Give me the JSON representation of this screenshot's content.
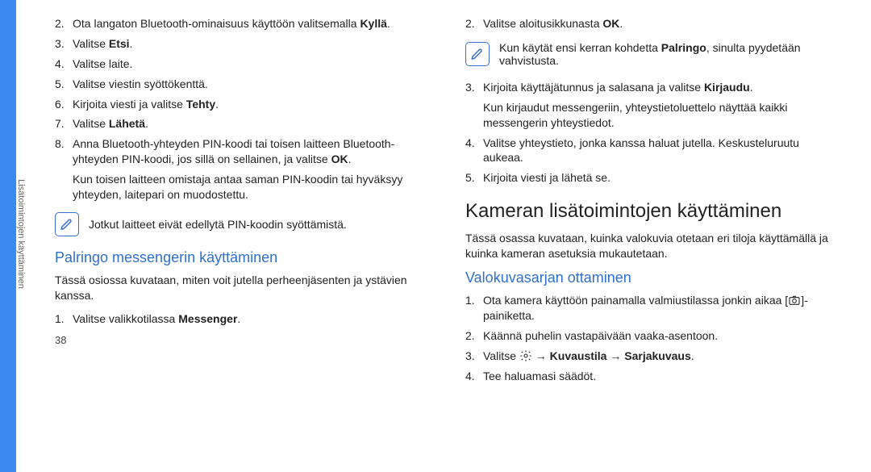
{
  "sidebar": {
    "label": "Lisätoimintojen käyttäminen"
  },
  "left": {
    "steps_a": [
      {
        "n": "2.",
        "pre": "Ota langaton Bluetooth-ominaisuus käyttöön valitsemalla ",
        "bold": "Kyllä",
        "post": "."
      },
      {
        "n": "3.",
        "pre": "Valitse ",
        "bold": "Etsi",
        "post": "."
      },
      {
        "n": "4.",
        "pre": "Valitse laite.",
        "bold": "",
        "post": ""
      },
      {
        "n": "5.",
        "pre": "Valitse viestin syöttökenttä.",
        "bold": "",
        "post": ""
      },
      {
        "n": "6.",
        "pre": "Kirjoita viesti ja valitse ",
        "bold": "Tehty",
        "post": "."
      },
      {
        "n": "7.",
        "pre": "Valitse ",
        "bold": "Lähetä",
        "post": "."
      },
      {
        "n": "8.",
        "pre": "Anna Bluetooth-yhteyden PIN-koodi tai toisen laitteen Bluetooth-yhteyden PIN-koodi, jos sillä on sellainen, ja valitse ",
        "bold": "OK",
        "post": "."
      }
    ],
    "sub8": "Kun toisen laitteen omistaja antaa saman PIN-koodin tai hyväksyy yhteyden, laitepari on muodostettu.",
    "note1": "Jotkut laitteet eivät edellytä PIN-koodin syöttämistä.",
    "h_palringo": "Palringo messengerin käyttäminen",
    "palringo_lede": "Tässä osiossa kuvataan, miten voit jutella perheenjäsenten ja ystävien kanssa.",
    "steps_b1": {
      "n": "1.",
      "pre": "Valitse valikkotilassa ",
      "bold": "Messenger",
      "post": "."
    }
  },
  "right": {
    "steps_b2": {
      "n": "2.",
      "pre": "Valitse aloitusikkunasta ",
      "bold": "OK",
      "post": "."
    },
    "note2_pre": "Kun käytät ensi kerran kohdetta ",
    "note2_bold": "Palringo",
    "note2_post": ", sinulta pyydetään vahvistusta.",
    "steps_c": [
      {
        "n": "3.",
        "pre": "Kirjoita käyttäjätunnus ja salasana ja valitse ",
        "bold": "Kirjaudu",
        "post": "."
      }
    ],
    "sub3": "Kun kirjaudut messengeriin, yhteystietoluettelo näyttää kaikki messengerin yhteystiedot.",
    "steps_d": [
      {
        "n": "4.",
        "pre": "Valitse yhteystieto, jonka kanssa haluat jutella. Keskusteluruutu aukeaa.",
        "bold": "",
        "post": ""
      },
      {
        "n": "5.",
        "pre": "Kirjoita viesti ja lähetä se.",
        "bold": "",
        "post": ""
      }
    ],
    "h_kamera": "Kameran lisätoimintojen käyttäminen",
    "kamera_lede": "Tässä osassa kuvataan, kuinka valokuvia otetaan eri tiloja käyttämällä ja kuinka kameran asetuksia mukautetaan.",
    "h_valokuva": "Valokuvasarjan ottaminen",
    "steps_e1": {
      "n": "1.",
      "pre": "Ota kamera käyttöön painamalla valmiustilassa jonkin aikaa [",
      "post": "]-painiketta."
    },
    "steps_e2": {
      "n": "2.",
      "txt": "Käännä puhelin vastapäivään vaaka-asentoon."
    },
    "steps_e3": {
      "n": "3.",
      "pre": "Valitse ",
      "mid": " → ",
      "bold1": "Kuvaustila",
      "bold2": "Sarjakuvaus",
      "post": "."
    },
    "steps_e4": {
      "n": "4.",
      "txt": "Tee haluamasi säädöt."
    }
  },
  "pagenum": "38"
}
